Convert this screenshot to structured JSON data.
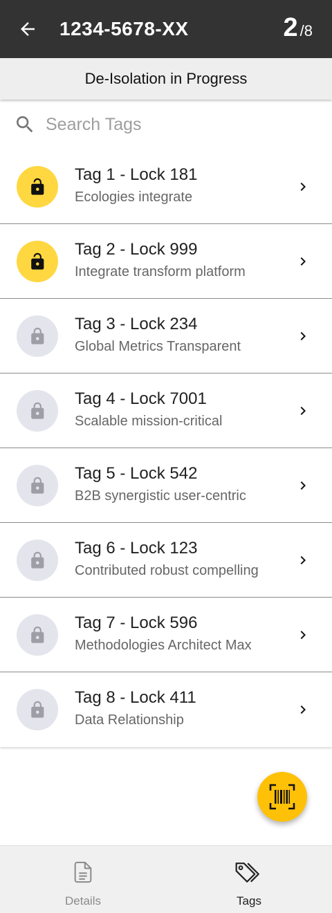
{
  "header": {
    "title": "1234-5678-XX",
    "counter_current": "2",
    "counter_total": "/8",
    "back_icon": "arrow-left-icon"
  },
  "status": {
    "text": "De-Isolation in Progress"
  },
  "search": {
    "placeholder": "Search Tags",
    "value": ""
  },
  "tags": [
    {
      "title": "Tag 1 - Lock 181",
      "subtitle": "Ecologies integrate",
      "lock_state": "unlocked"
    },
    {
      "title": "Tag 2 - Lock 999",
      "subtitle": "Integrate transform platform",
      "lock_state": "unlocked"
    },
    {
      "title": "Tag 3 - Lock 234",
      "subtitle": "Global Metrics Transparent",
      "lock_state": "locked"
    },
    {
      "title": "Tag 4 - Lock 7001",
      "subtitle": "Scalable mission-critical",
      "lock_state": "locked"
    },
    {
      "title": "Tag 5 - Lock 542",
      "subtitle": "B2B synergistic user-centric",
      "lock_state": "locked"
    },
    {
      "title": "Tag 6 - Lock 123",
      "subtitle": "Contributed robust compelling",
      "lock_state": "locked"
    },
    {
      "title": "Tag 7 - Lock 596",
      "subtitle": "Methodologies Architect Max",
      "lock_state": "locked"
    },
    {
      "title": "Tag 8 - Lock 411",
      "subtitle": "Data Relationship",
      "lock_state": "locked"
    }
  ],
  "fab": {
    "icon": "barcode-scan-icon"
  },
  "bottom_nav": {
    "items": [
      {
        "label": "Details",
        "icon": "document-icon",
        "active": false
      },
      {
        "label": "Tags",
        "icon": "tags-icon",
        "active": true
      }
    ]
  },
  "colors": {
    "app_bar": "#333333",
    "unlocked": "#ffd740",
    "locked": "#e4e5ec",
    "fab": "#ffc107"
  }
}
